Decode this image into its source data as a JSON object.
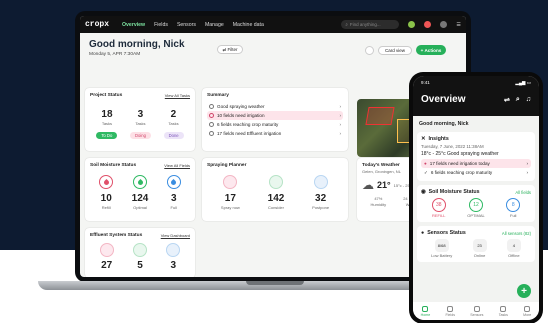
{
  "laptop": {
    "nav": {
      "logo": "cropx",
      "items": [
        "Overview",
        "Fields",
        "Sensors",
        "Manage",
        "Machine data"
      ],
      "search_placeholder": "Find anything..."
    },
    "greeting": "Good morning, Nick",
    "date": "Monday 5, APR 7:30AM",
    "filter_label": "Filter",
    "card_view_label": "Card view",
    "actions_label": "+ Actions",
    "project_status": {
      "title": "Project Status",
      "link": "View All Tasks",
      "stats": [
        {
          "value": "18",
          "label": "Tasks"
        },
        {
          "value": "3",
          "label": "Tasks"
        },
        {
          "value": "2",
          "label": "Tasks"
        }
      ],
      "pills": [
        "To Do",
        "Doing",
        "Done"
      ]
    },
    "summary": {
      "title": "Summary",
      "rows": [
        "Good spraying weather",
        "10 fields need irrigation",
        "6 fields reaching crop maturity",
        "17 fields need Effluent irrigation"
      ]
    },
    "soil_moisture": {
      "title": "Soil Moisture Status",
      "link": "View All Fields",
      "stats": [
        {
          "value": "10",
          "label": "Refill"
        },
        {
          "value": "124",
          "label": "Optimal"
        },
        {
          "value": "3",
          "label": "Full"
        }
      ]
    },
    "spraying": {
      "title": "Spraying Planner",
      "stats": [
        {
          "value": "17",
          "label": "Spray now"
        },
        {
          "value": "142",
          "label": "Consider"
        },
        {
          "value": "32",
          "label": "Postpone"
        }
      ]
    },
    "weather": {
      "title": "Today's Weather",
      "location": "Gelen, Groningen, NL",
      "temp": "21°",
      "range": "15°c - 25°c",
      "humidity_value": "47%",
      "humidity_label": "Humidity",
      "wind_value": "24 km/h",
      "wind_label": "Wind"
    },
    "effluent": {
      "title": "Effluent System Status",
      "link": "View Dashboard",
      "stats": [
        {
          "value": "27"
        },
        {
          "value": "5"
        },
        {
          "value": "3"
        }
      ]
    }
  },
  "phone": {
    "time": "9:41",
    "title": "Overview",
    "greeting": "Good morning, Nick",
    "insights": {
      "title": "Insights",
      "date": "Tuesday, 7 June, 2022 11:38AM",
      "weather": "18°c - 25°c Good spraying weather",
      "rows": [
        "17 fields need irrigation today",
        "6 fields reaching crop maturity"
      ]
    },
    "soil": {
      "title": "Soil Moisture Status",
      "link": "All fields",
      "stats": [
        {
          "value": "38",
          "label": "REFILL"
        },
        {
          "value": "12",
          "label": "OPTIMAL"
        },
        {
          "value": "8",
          "label": "Full"
        }
      ]
    },
    "sensors": {
      "title": "Sensors Status",
      "link": "All sensors (82)",
      "stats": [
        {
          "value": "8/68",
          "label": "Low Battery"
        },
        {
          "value": "23",
          "label": "Online"
        },
        {
          "value": "4",
          "label": "Offline"
        }
      ]
    },
    "nav": [
      "Home",
      "Fields",
      "Sensors",
      "Tasks",
      "More"
    ]
  },
  "colors": {
    "accent": "#26b05a",
    "background": "#0d1b31",
    "alert": "#e0506a"
  }
}
